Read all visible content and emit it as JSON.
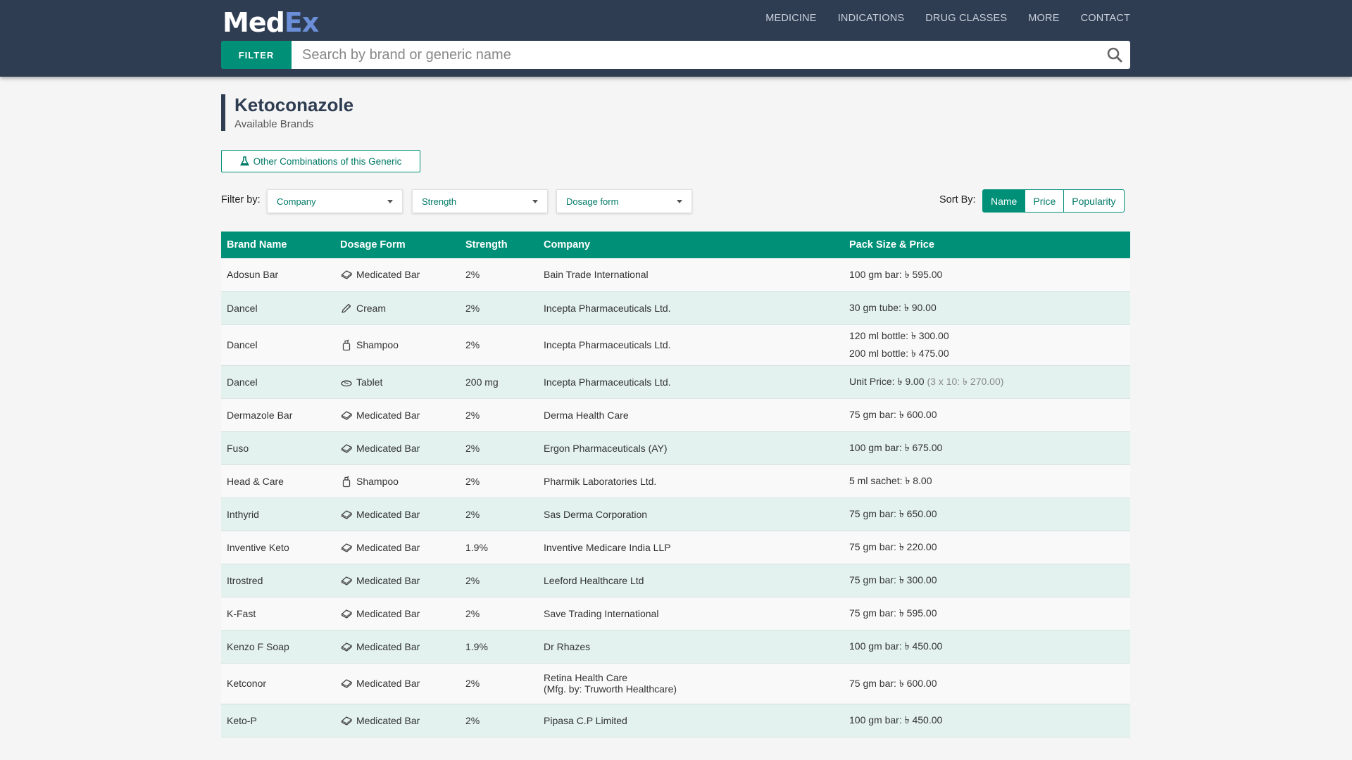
{
  "brand": {
    "logo_part1": "Med",
    "logo_part2": "Ex"
  },
  "nav": [
    "MEDICINE",
    "INDICATIONS",
    "DRUG CLASSES",
    "MORE",
    "CONTACT"
  ],
  "search": {
    "filter_label": "FILTER",
    "placeholder": "Search by brand or generic name"
  },
  "page": {
    "title": "Ketoconazole",
    "subtitle": "Available Brands",
    "combo_button": "Other Combinations of this Generic"
  },
  "filters": {
    "label": "Filter by:",
    "company": "Company",
    "strength": "Strength",
    "dosage_form": "Dosage form"
  },
  "sort": {
    "label": "Sort By:",
    "options": [
      "Name",
      "Price",
      "Popularity"
    ],
    "active": "Name"
  },
  "table": {
    "headers": [
      "Brand Name",
      "Dosage Form",
      "Strength",
      "Company",
      "Pack Size & Price"
    ],
    "rows": [
      {
        "brand": "Adosun Bar",
        "icon": "medicated-bar-icon",
        "form": "Medicated Bar",
        "strength": "2%",
        "company": "Bain Trade International",
        "company2": "",
        "prices": [
          "100 gm bar: ৳ 595.00"
        ],
        "extra": ""
      },
      {
        "brand": "Dancel",
        "icon": "cream-icon",
        "form": "Cream",
        "strength": "2%",
        "company": "Incepta Pharmaceuticals Ltd.",
        "company2": "",
        "prices": [
          "30 gm tube: ৳ 90.00"
        ],
        "extra": ""
      },
      {
        "brand": "Dancel",
        "icon": "shampoo-icon",
        "form": "Shampoo",
        "strength": "2%",
        "company": "Incepta Pharmaceuticals Ltd.",
        "company2": "",
        "prices": [
          "120 ml bottle: ৳ 300.00",
          "200 ml bottle: ৳ 475.00"
        ],
        "extra": ""
      },
      {
        "brand": "Dancel",
        "icon": "tablet-icon",
        "form": "Tablet",
        "strength": "200 mg",
        "company": "Incepta Pharmaceuticals Ltd.",
        "company2": "",
        "prices": [
          "Unit Price: ৳ 9.00"
        ],
        "extra": "(3 x 10: ৳ 270.00)"
      },
      {
        "brand": "Dermazole Bar",
        "icon": "medicated-bar-icon",
        "form": "Medicated Bar",
        "strength": "2%",
        "company": "Derma Health Care",
        "company2": "",
        "prices": [
          "75 gm bar: ৳ 600.00"
        ],
        "extra": ""
      },
      {
        "brand": "Fuso",
        "icon": "medicated-bar-icon",
        "form": "Medicated Bar",
        "strength": "2%",
        "company": "Ergon Pharmaceuticals (AY)",
        "company2": "",
        "prices": [
          "100 gm bar: ৳ 675.00"
        ],
        "extra": ""
      },
      {
        "brand": "Head & Care",
        "icon": "shampoo-icon",
        "form": "Shampoo",
        "strength": "2%",
        "company": "Pharmik Laboratories Ltd.",
        "company2": "",
        "prices": [
          "5 ml sachet: ৳ 8.00"
        ],
        "extra": ""
      },
      {
        "brand": "Inthyrid",
        "icon": "medicated-bar-icon",
        "form": "Medicated Bar",
        "strength": "2%",
        "company": "Sas Derma Corporation",
        "company2": "",
        "prices": [
          "75 gm bar: ৳ 650.00"
        ],
        "extra": ""
      },
      {
        "brand": "Inventive Keto",
        "icon": "medicated-bar-icon",
        "form": "Medicated Bar",
        "strength": "1.9%",
        "company": "Inventive Medicare India LLP",
        "company2": "",
        "prices": [
          "75 gm bar: ৳ 220.00"
        ],
        "extra": ""
      },
      {
        "brand": "Itrostred",
        "icon": "medicated-bar-icon",
        "form": "Medicated Bar",
        "strength": "2%",
        "company": "Leeford Healthcare Ltd",
        "company2": "",
        "prices": [
          "75 gm bar: ৳ 300.00"
        ],
        "extra": ""
      },
      {
        "brand": "K-Fast",
        "icon": "medicated-bar-icon",
        "form": "Medicated Bar",
        "strength": "2%",
        "company": "Save Trading International",
        "company2": "",
        "prices": [
          "75 gm bar: ৳ 595.00"
        ],
        "extra": ""
      },
      {
        "brand": "Kenzo F Soap",
        "icon": "medicated-bar-icon",
        "form": "Medicated Bar",
        "strength": "1.9%",
        "company": "Dr Rhazes",
        "company2": "",
        "prices": [
          "100 gm bar: ৳ 450.00"
        ],
        "extra": ""
      },
      {
        "brand": "Ketconor",
        "icon": "medicated-bar-icon",
        "form": "Medicated Bar",
        "strength": "2%",
        "company": "Retina Health Care",
        "company2": "(Mfg. by: Truworth Healthcare)",
        "prices": [
          "75 gm bar: ৳ 600.00"
        ],
        "extra": ""
      },
      {
        "brand": "Keto-P",
        "icon": "medicated-bar-icon",
        "form": "Medicated Bar",
        "strength": "2%",
        "company": "Pipasa C.P Limited",
        "company2": "",
        "prices": [
          "100 gm bar: ৳ 450.00"
        ],
        "extra": ""
      }
    ]
  },
  "colors": {
    "navbar": "#2f3d52",
    "accent": "#009077",
    "row_alt": "#e3f2ef"
  }
}
